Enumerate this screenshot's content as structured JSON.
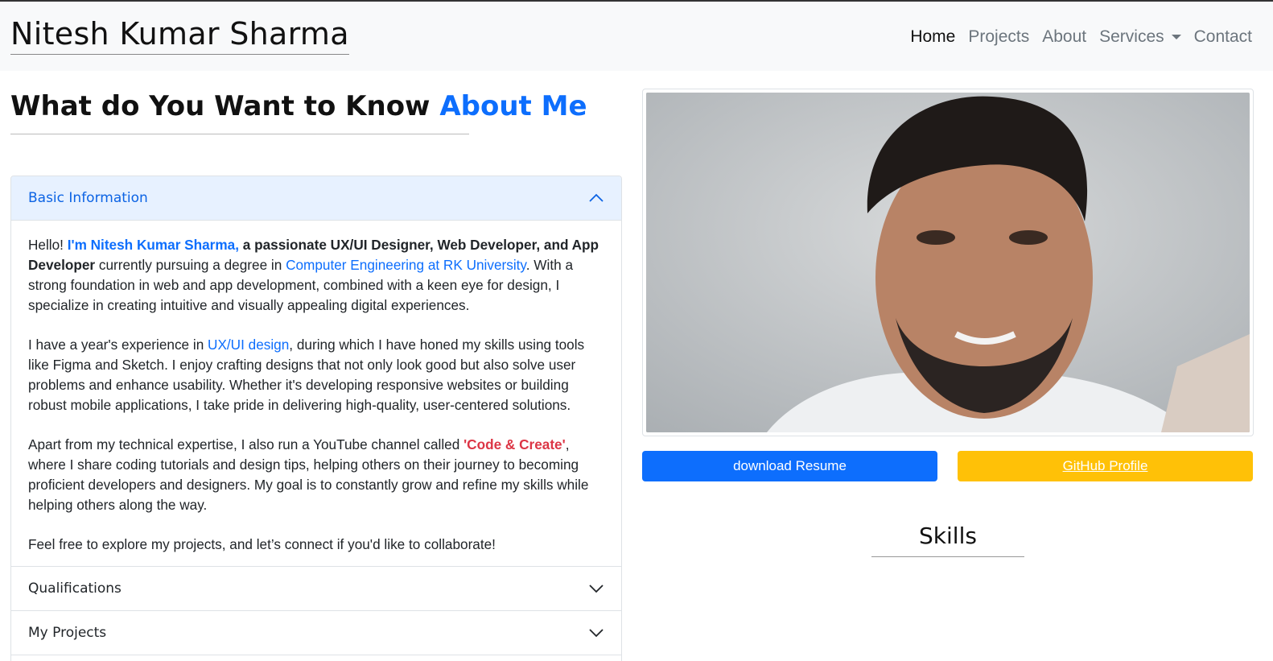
{
  "brand": "Nitesh Kumar Sharma",
  "nav": {
    "home": "Home",
    "projects": "Projects",
    "about": "About",
    "services": "Services",
    "contact": "Contact"
  },
  "heading": {
    "prefix": "What do You Want to Know ",
    "accent": "About Me"
  },
  "accordion": {
    "basic_info": "Basic Information",
    "qualifications": "Qualifications",
    "projects": "My Projects"
  },
  "about": {
    "p1_hello": "Hello! ",
    "p1_name": "I'm Nitesh Kumar Sharma,",
    "p1_role": " a passionate UX/UI Designer, Web Developer, and App Developer",
    "p1_mid": " currently pursuing a degree in ",
    "p1_link": "Computer Engineering at RK University",
    "p1_rest": ". With a strong foundation in web and app development, combined with a keen eye for design, I specialize in creating intuitive and visually appealing digital experiences.",
    "p2_start": "I have a year's experience in ",
    "p2_link": "UX/UI design",
    "p2_rest": ", during which I have honed my skills using tools like Figma and Sketch. I enjoy crafting designs that not only look good but also solve user problems and enhance usability. Whether it's developing responsive websites or building robust mobile applications, I take pride in delivering high-quality, user-centered solutions.",
    "p3_start": "Apart from my technical expertise, I also run a YouTube channel called ",
    "p3_channel": "'Code & Create'",
    "p3_rest": ", where I share coding tutorials and design tips, helping others on their journey to becoming proficient developers and designers. My goal is to constantly grow and refine my skills while helping others along the way.",
    "p4": "Feel free to explore my projects, and let’s connect if you'd like to collaborate!"
  },
  "buttons": {
    "resume": "download Resume",
    "github": "GitHub Profile"
  },
  "skills_title": "Skills",
  "colors": {
    "primary": "#0d6efd",
    "warning": "#ffc107",
    "danger": "#dc3545",
    "navbar_bg": "#f8f9fa"
  }
}
